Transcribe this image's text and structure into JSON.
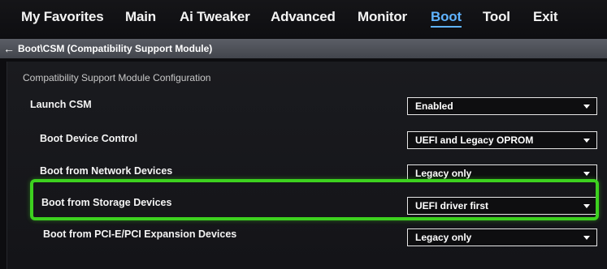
{
  "menu": {
    "items": [
      {
        "label": "My Favorites"
      },
      {
        "label": "Main"
      },
      {
        "label": "Ai Tweaker"
      },
      {
        "label": "Advanced"
      },
      {
        "label": "Monitor"
      },
      {
        "label": "Boot"
      },
      {
        "label": "Tool"
      },
      {
        "label": "Exit"
      }
    ],
    "active": "Boot"
  },
  "breadcrumb": {
    "path": "Boot\\CSM (Compatibility Support Module)"
  },
  "section": {
    "title": "Compatibility Support Module Configuration"
  },
  "settings": [
    {
      "label": "Launch CSM",
      "value": "Enabled"
    },
    {
      "label": "Boot Device Control",
      "value": "UEFI and Legacy OPROM"
    },
    {
      "label": "Boot from Network Devices",
      "value": "Legacy only"
    },
    {
      "label": "Boot from Storage Devices",
      "value": "UEFI driver first"
    },
    {
      "label": "Boot from PCI-E/PCI Expansion Devices",
      "value": "Legacy only"
    }
  ],
  "colors": {
    "active_tab": "#5fb3ff",
    "highlight": "#3dd11f",
    "breadcrumb_bg": "#4c4f57"
  }
}
